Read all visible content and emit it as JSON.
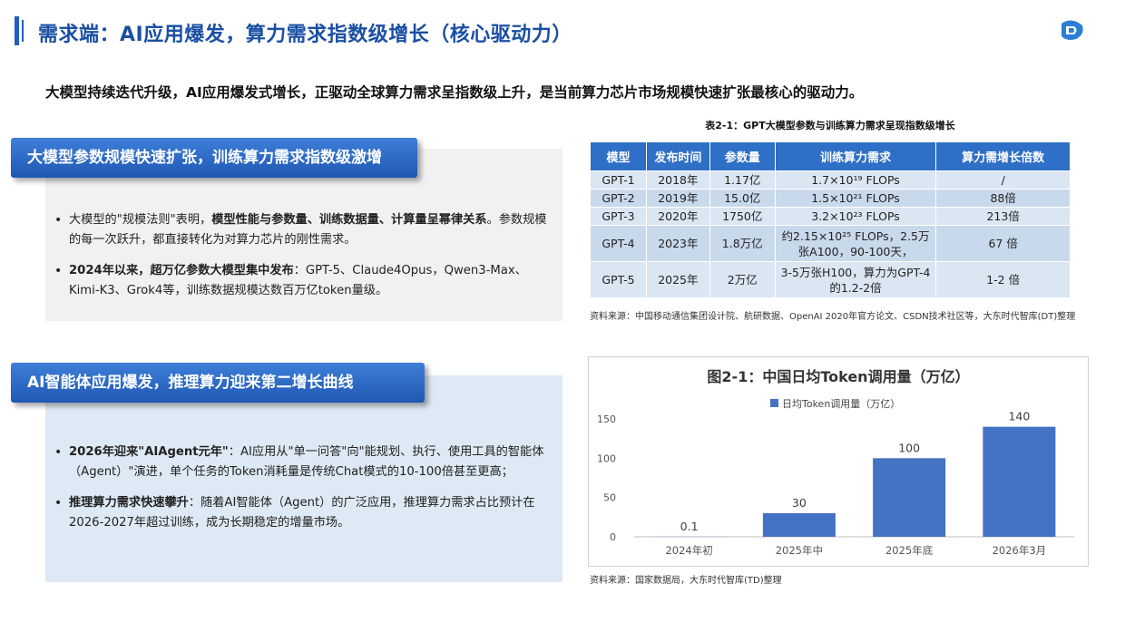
{
  "header": {
    "title": "需求端：AI应用爆发，算力需求指数级增长（核心驱动力）"
  },
  "lead": "大模型持续迭代升级，AI应用爆发式增长，正驱动全球算力需求呈指数级上升，是当前算力芯片市场规模快速扩张最核心的驱动力。",
  "section1": {
    "heading": "大模型参数规模快速扩张，训练算力需求指数级激增",
    "bullet1_pre": "大模型的\"规模法则\"表明，",
    "bullet1_bold": "模型性能与参数量、训练数据量、计算量呈幂律关系",
    "bullet1_post": "。参数规模的每一次跃升，都直接转化为对算力芯片的刚性需求。",
    "bullet2_bold": "2024年以来，超万亿参数大模型集中发布",
    "bullet2_post": "：GPT-5、Claude4Opus，Qwen3-Max、Kimi-K3、Grok4等，训练数据规模达数百万亿token量级。"
  },
  "section2": {
    "heading": "AI智能体应用爆发，推理算力迎来第二增长曲线",
    "bullet1_bold": "2026年迎来\"AIAgent元年\"",
    "bullet1_post": "：AI应用从\"单一问答\"向\"能规划、执行、使用工具的智能体（Agent）\"演进，单个任务的Token消耗量是传统Chat模式的10-100倍甚至更高；",
    "bullet2_bold": "推理算力需求快速攀升",
    "bullet2_post": "：随着AI智能体（Agent）的广泛应用，推理算力需求占比预计在2026-2027年超过训练，成为长期稳定的增量市场。"
  },
  "table": {
    "caption": "表2-1：GPT大模型参数与训练算力需求呈现指数级增长",
    "headers": [
      "模型",
      "发布时间",
      "参数量",
      "训练算力需求",
      "算力需增长倍数"
    ],
    "rows": [
      {
        "model": "GPT-1",
        "year": "2018年",
        "params": "1.17亿",
        "flops": "1.7×10¹⁹ FLOPs",
        "growth": "/"
      },
      {
        "model": "GPT-2",
        "year": "2019年",
        "params": "15.0亿",
        "flops": "1.5×10²¹ FLOPs",
        "growth": "88倍"
      },
      {
        "model": "GPT-3",
        "year": "2020年",
        "params": "1750亿",
        "flops": "3.2×10²³ FLOPs",
        "growth": "213倍"
      },
      {
        "model": "GPT-4",
        "year": "2023年",
        "params": "1.8万亿",
        "flops": "约2.15×10²⁵ FLOPs，2.5万张A100，90-100天，",
        "growth": "67 倍"
      },
      {
        "model": "GPT-5",
        "year": "2025年",
        "params": "2万亿",
        "flops": "3-5万张H100，算力为GPT-4的1.2-2倍",
        "growth": "1-2 倍"
      }
    ],
    "source": "资料来源：中国移动通信集团设计院、航研数据、OpenAI 2020年官方论文、CSDN技术社区等，大东时代智库(DT)整理"
  },
  "chart_data": {
    "type": "bar",
    "title": "图2-1：中国日均Token调用量（万亿）",
    "categories": [
      "2024年初",
      "2025年中",
      "2025年底",
      "2026年3月"
    ],
    "series": [
      {
        "name": "日均Token调用量（万亿）",
        "values": [
          0.1,
          30,
          100,
          140
        ]
      }
    ],
    "value_labels": [
      "0.1",
      "30",
      "100",
      "140"
    ],
    "ylim": [
      0,
      150
    ],
    "yticks": [
      0,
      50,
      100,
      150
    ],
    "grid": false,
    "legend": "top-left",
    "color": "#4472c4",
    "source": "资料来源：国家数据局，大东时代智库(TD)整理"
  }
}
